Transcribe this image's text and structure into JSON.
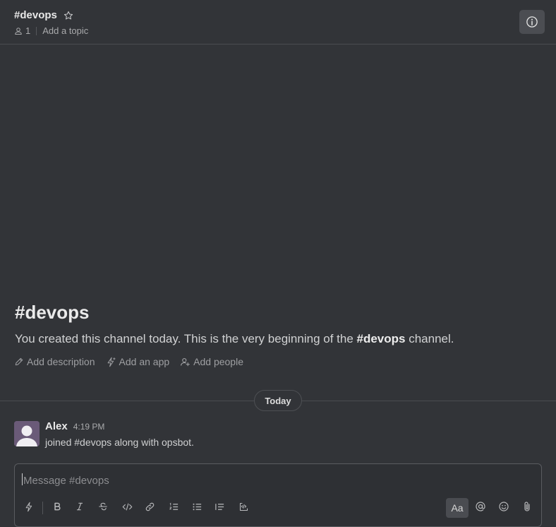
{
  "header": {
    "channel_name": "#devops",
    "member_count": "1",
    "add_topic_label": "Add a topic"
  },
  "intro": {
    "title": "#devops",
    "text_before": "You created this channel today. This is the very beginning of the ",
    "text_channel": "#devops",
    "text_after": " channel.",
    "actions": [
      {
        "label": "Add description",
        "icon": "pencil-icon"
      },
      {
        "label": "Add an app",
        "icon": "lightning-plus-icon"
      },
      {
        "label": "Add people",
        "icon": "person-add-icon"
      }
    ]
  },
  "divider_label": "Today",
  "messages": [
    {
      "author": "Alex",
      "time": "4:19 PM",
      "text": "joined #devops along with opsbot."
    }
  ],
  "composer": {
    "placeholder": "Message #devops",
    "toolbar": [
      "shortcuts-icon",
      "bold-icon",
      "italic-icon",
      "strikethrough-icon",
      "code-icon",
      "link-icon",
      "ordered-list-icon",
      "bulleted-list-icon",
      "blockquote-icon",
      "code-block-icon",
      "Aa",
      "mention-icon",
      "emoji-icon",
      "attachment-icon"
    ],
    "format_label": "Aa"
  },
  "colors": {
    "background": "#323438",
    "composer_bg": "#2e3034",
    "avatar": "#6a5a78",
    "text": "#d1d2d3"
  }
}
